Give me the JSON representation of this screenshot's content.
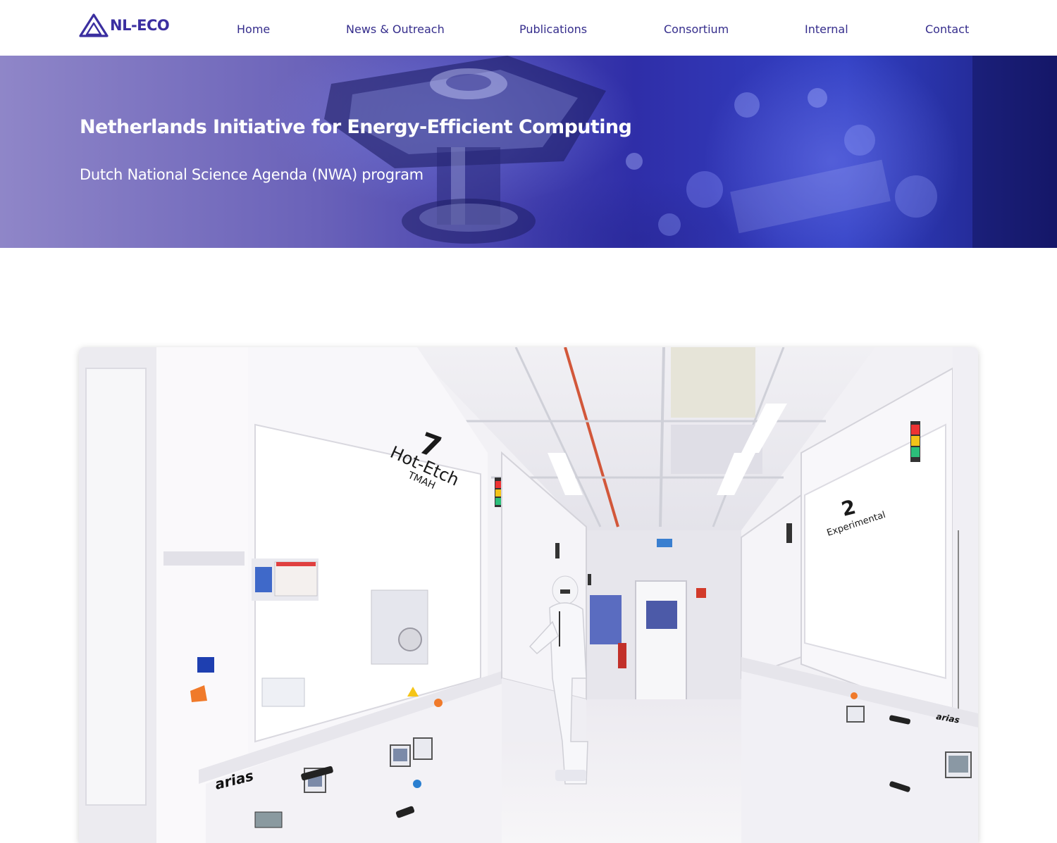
{
  "site": {
    "logo_text": "NL-ECO",
    "logo_icon": "triangle-logo-icon",
    "brand_color": "#3b2fa0",
    "nav_color": "#352d8c"
  },
  "nav": {
    "items": [
      {
        "label": "Home"
      },
      {
        "label": "News & Outreach"
      },
      {
        "label": "Publications"
      },
      {
        "label": "Consortium"
      },
      {
        "label": "Internal"
      },
      {
        "label": "Contact"
      }
    ]
  },
  "hero": {
    "title": "Netherlands Initiative for Energy-Efficient Computing",
    "subtitle": "Dutch National Science Agenda (NWA) program"
  },
  "photo": {
    "station_7_number": "7",
    "station_7_name": "Hot-Etch",
    "station_7_sub": "TMAH",
    "station_2_number": "2",
    "station_2_name": "Experimental",
    "bench_brand_left": "arias",
    "bench_brand_right": "arias"
  }
}
